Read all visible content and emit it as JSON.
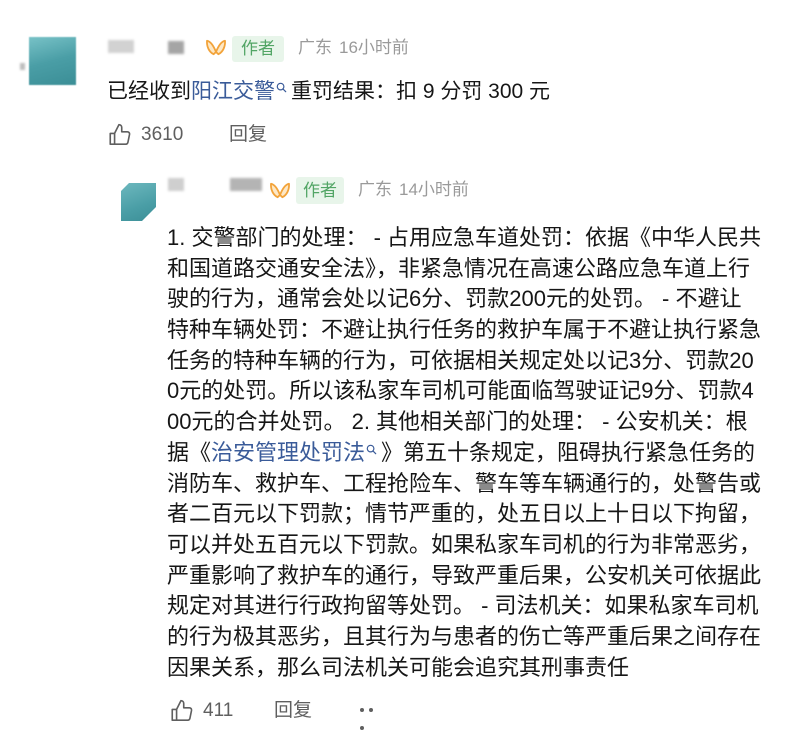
{
  "colors": {
    "body_text": "#161616",
    "link": "#3a5b99",
    "meta": "#9a9a9a",
    "action": "#5f5f5f",
    "author_badge_text": "#52a565",
    "author_badge_bg": "#e8f5ea",
    "avatar": "#4a9ea6",
    "badge_icon": "#f2a33a"
  },
  "icons": {
    "like": "thumbs-up-icon",
    "search": "search-icon",
    "creator_badge": "butterfly-badge-icon",
    "more": "more-icon"
  },
  "comment": {
    "author_badge": "作者",
    "location": "广东",
    "time": "16小时前",
    "text": [
      {
        "text": "已经收到"
      },
      {
        "text": "阳江交警",
        "link": true
      },
      {
        "text": "重罚结果：扣 9 分罚 300 元"
      }
    ],
    "likes": "3610",
    "reply_label": "回复"
  },
  "reply": {
    "author_badge": "作者",
    "location": "广东",
    "time": "14小时前",
    "lines": [
      [
        {
          "text": "1. 交警部门的处理： - 占用应急车道处罚：依据《中华人民共"
        }
      ],
      [
        {
          "text": "和国道路交通安全法》，非紧急情况在高速公路应急车道上行"
        }
      ],
      [
        {
          "text": "驶的行为，通常会处以记6分、罚款200元的处罚。 - 不避让"
        }
      ],
      [
        {
          "text": "特种车辆处罚：不避让执行任务的救护车属于不避让执行紧急"
        }
      ],
      [
        {
          "text": "任务的特种车辆的行为，可依据相关规定处以记3分、罚款20"
        }
      ],
      [
        {
          "text": "0元的处罚。所以该私家车司机可能面临驾驶证记9分、罚款4"
        }
      ],
      [
        {
          "text": "00元的合并处罚。 2. 其他相关部门的处理： - 公安机关：根"
        }
      ],
      [
        {
          "text": "据《"
        },
        {
          "text": "治安管理处罚法",
          "link": true
        },
        {
          "text": "》第五十条规定，阻碍执行紧急任务的"
        }
      ],
      [
        {
          "text": "消防车、救护车、工程抢险车、警车等车辆通行的，处警告或"
        }
      ],
      [
        {
          "text": "者二百元以下罚款；情节严重的，处五日以上十日以下拘留，"
        }
      ],
      [
        {
          "text": "可以并处五百元以下罚款。如果私家车司机的行为非常恶劣，"
        }
      ],
      [
        {
          "text": "严重影响了救护车的通行，导致严重后果，公安机关可依据此"
        }
      ],
      [
        {
          "text": "规定对其进行行政拘留等处罚。 - 司法机关：如果私家车司机"
        }
      ],
      [
        {
          "text": "的行为极其恶劣，且其行为与患者的伤亡等严重后果之间存在"
        }
      ],
      [
        {
          "text": "因果关系，那么司法机关可能会追究其刑事责任"
        }
      ]
    ],
    "likes": "411",
    "reply_label": "回复"
  }
}
